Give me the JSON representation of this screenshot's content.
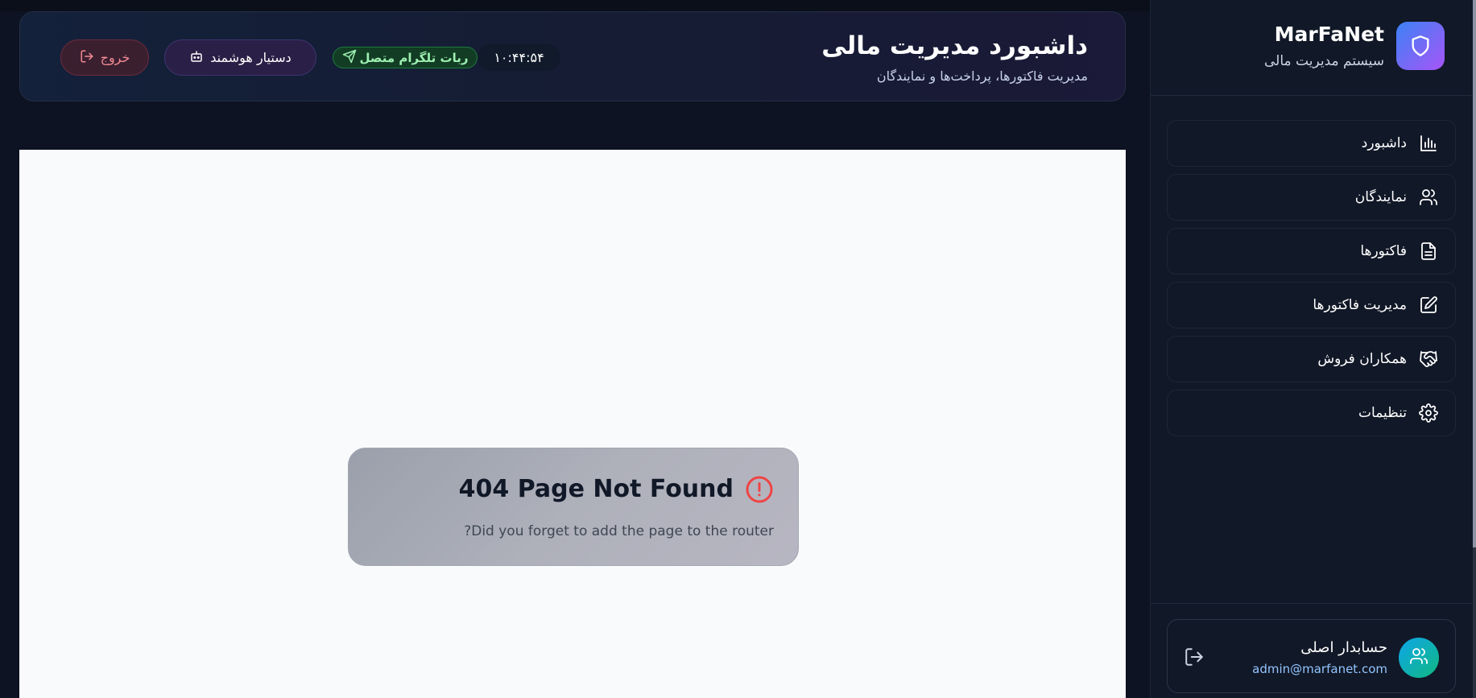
{
  "header": {
    "title": "داشبورد مدیریت مالی",
    "subtitle": "مدیریت فاکتورها، پرداخت‌ها و نمایندگان",
    "clock": "۱۰:۴۴:۵۴",
    "telegram_status": "ربات تلگرام متصل",
    "assistant_label": "دستیار هوشمند",
    "logout_label": "خروج"
  },
  "main": {
    "not_found": {
      "title": "404 Page Not Found",
      "message": "Did you forget to add the page to the router?"
    }
  },
  "sidebar": {
    "brand": {
      "name": "MarFaNet",
      "tagline": "سیستم مدیریت مالی",
      "icon": "shield-icon"
    },
    "items": [
      {
        "label": "داشبورد",
        "icon": "bar-chart-icon"
      },
      {
        "label": "نمایندگان",
        "icon": "users-icon"
      },
      {
        "label": "فاکتورها",
        "icon": "file-text-icon"
      },
      {
        "label": "مدیریت فاکتورها",
        "icon": "edit-icon"
      },
      {
        "label": "همکاران فروش",
        "icon": "handshake-icon"
      },
      {
        "label": "تنظیمات",
        "icon": "gear-icon"
      }
    ],
    "user": {
      "name": "حسابدار اصلی",
      "email": "admin@marfanet.com"
    }
  },
  "colors": {
    "background": "#0d1322",
    "sidebar": "#111827",
    "brand_gradient_start": "#3b82f6",
    "brand_gradient_end": "#a855f7",
    "telegram_green": "#9ef0b2",
    "logout_red": "#f28b93",
    "error_red": "#ef4444"
  }
}
